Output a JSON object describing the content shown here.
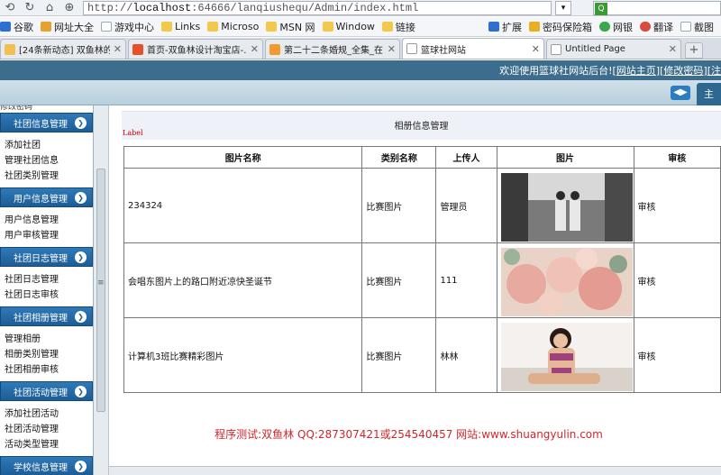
{
  "browser": {
    "url_prefix": "http://",
    "url_host": "localhost",
    "url_rest": ":64666/lanqiushequ/Admin/index.html",
    "bookmarks": [
      "谷歌",
      "网址大全",
      "游戏中心",
      "Links",
      "Microso",
      "MSN 网",
      "Window",
      "链接"
    ],
    "bookmarks_right": [
      "扩展",
      "密码保险箱",
      "网银",
      "翻译",
      "截图"
    ],
    "tabs": [
      {
        "label": "[24条新动态] 双鱼林的...",
        "active": false
      },
      {
        "label": "首页-双鱼林设计淘宝店-...",
        "active": false
      },
      {
        "label": "第二十二条婚规_全集_在...",
        "active": false
      },
      {
        "label": "篮球社网站",
        "active": true
      },
      {
        "label": "Untitled Page",
        "active": false
      }
    ]
  },
  "header": {
    "welcome": "欢迎使用篮球社网站后台!",
    "open_bracket": "[",
    "close_bracket": "]",
    "home_link": "网站主页",
    "password_link": "修改密码",
    "trailing": "[注",
    "main_tab": "主"
  },
  "sidebar": {
    "top_text": "修改密码",
    "groups": [
      {
        "title": "社团信息管理",
        "items": [
          "添加社团",
          "管理社团信息",
          "社团类别管理"
        ]
      },
      {
        "title": "用户信息管理",
        "items": [
          "用户信息管理",
          "用户审核管理"
        ]
      },
      {
        "title": "社团日志管理",
        "items": [
          "社团日志管理",
          "社团日志审核"
        ]
      },
      {
        "title": "社团相册管理",
        "items": [
          "管理相册",
          "相册类别管理",
          "社团相册审核"
        ]
      },
      {
        "title": "社团活动管理",
        "items": [
          "添加社团活动",
          "社团活动管理",
          "活动类型管理"
        ]
      },
      {
        "title": "学校信息管理",
        "items": []
      }
    ]
  },
  "panel": {
    "title": "相册信息管理",
    "label": "Label"
  },
  "table": {
    "headers": [
      "图片名称",
      "类别名称",
      "上传人",
      "图片",
      "审核"
    ],
    "rows": [
      {
        "name": "234324",
        "category": "比赛图片",
        "uploader": "管理员",
        "image": "twin-girls-photo",
        "audit": "审核"
      },
      {
        "name": "会唱东图片上的路口附近凉快圣诞节",
        "category": "比赛图片",
        "uploader": "111",
        "image": "pink-flowers-photo",
        "audit": "审核"
      },
      {
        "name": "计算机3班比赛精彩图片",
        "category": "比赛图片",
        "uploader": "林林",
        "image": "bikini-girl-photo",
        "audit": "审核"
      }
    ]
  },
  "footer": {
    "text": "程序测试:双鱼林 QQ:287307421或254540457 网站:www.shuangyulin.com"
  },
  "colors": {
    "header_bg": "#3d6d8d",
    "sidebar_head": "#1d5d95",
    "footer_text": "#d0262b",
    "label_red": "#cc0000"
  }
}
